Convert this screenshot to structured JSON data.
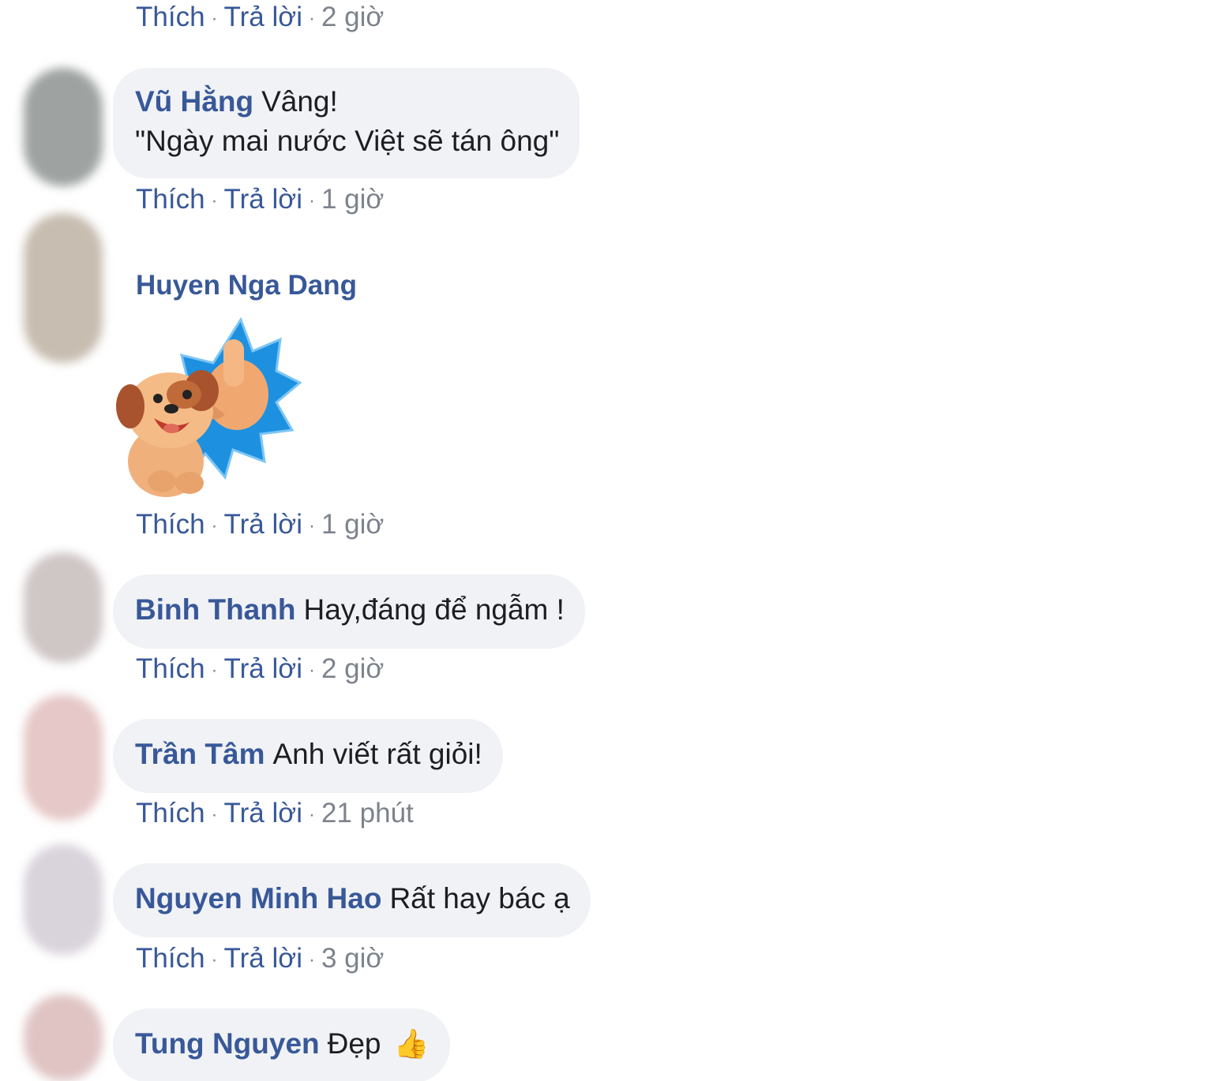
{
  "action_labels": {
    "like": "Thích",
    "reply": "Trả lời",
    "separator": "·"
  },
  "top_actions": {
    "time": "2 giờ"
  },
  "comments": [
    {
      "author": "Vũ Hằng",
      "line1": "Vâng!",
      "line2": "\"Ngày mai nước Việt sẽ tán ông\"",
      "time": "1 giờ"
    },
    {
      "author": "Huyen Nga Dang",
      "sticker": "thumbs-up-puppy-sticker",
      "time": "1 giờ"
    },
    {
      "author": "Binh Thanh",
      "text": "Hay,đáng để ngẫm !",
      "time": "2 giờ"
    },
    {
      "author": "Trần Tâm",
      "text": "Anh viết rất giỏi!",
      "time": "21 phút"
    },
    {
      "author": "Nguyen Minh Hao",
      "text": "Rất hay bác ạ",
      "time": "3 giờ"
    },
    {
      "author": "Tung Nguyen",
      "text": "Đẹp",
      "emoji": "👍"
    }
  ],
  "colors": {
    "name": "#385898",
    "bubble": "#f0f2f5",
    "meta": "#7d838c",
    "sticker_burst": "#1e90e0"
  }
}
